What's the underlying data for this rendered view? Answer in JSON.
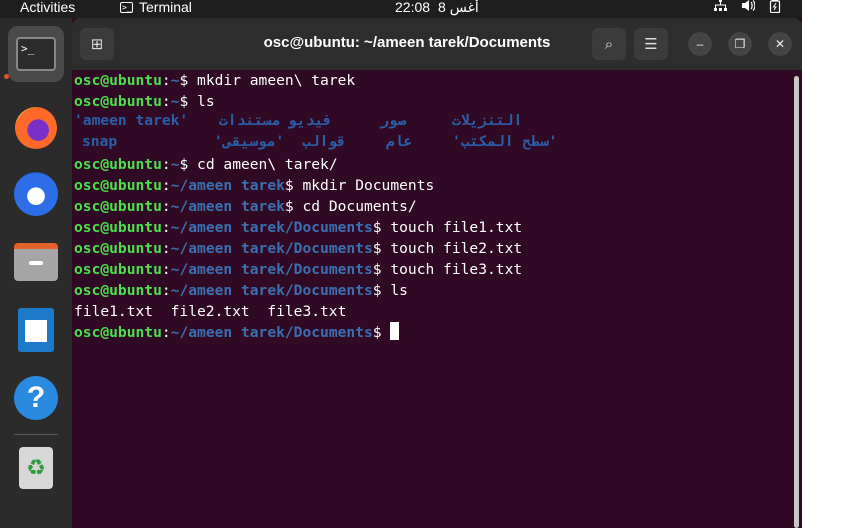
{
  "topbar": {
    "activities": "Activities",
    "app_name": "Terminal",
    "clock_time": "22:08",
    "clock_date": "8 أغس",
    "tray_icons": [
      "network-icon",
      "volume-icon",
      "battery-icon"
    ]
  },
  "dock": {
    "items": [
      "terminal",
      "firefox",
      "thunderbird",
      "files",
      "libreoffice-writer",
      "help",
      "trash"
    ]
  },
  "window": {
    "title": "osc@ubuntu: ~/ameen tarek/Documents",
    "new_tab_icon": "⊞",
    "search_icon": "⌕",
    "menu_icon": "☰",
    "minimize_icon": "–",
    "maximize_icon": "❐",
    "close_icon": "✕"
  },
  "terminal": {
    "user": "osc@ubuntu",
    "colon": ":",
    "home_path": "~",
    "path_ameen": "~/ameen tarek",
    "path_docs": "~/ameen tarek/Documents",
    "prompt_char": "$ ",
    "cmd1": "mkdir ameen\\ tarek",
    "cmd2": "ls",
    "ls_home": {
      "row1": [
        "'ameen tarek'",
        "مستندات",
        "فيديو",
        "صور",
        "التنزيلات"
      ],
      "row2": [
        "snap",
        "'سطح المكتب'",
        "عام",
        "قوالب",
        "'موسيقى'"
      ]
    },
    "cmd3": "cd ameen\\ tarek/",
    "cmd4": "mkdir Documents",
    "cmd5": "cd Documents/",
    "cmd6": "touch file1.txt",
    "cmd7": "touch file2.txt",
    "cmd8": "touch file3.txt",
    "cmd9": "ls",
    "ls_docs": "file1.txt  file2.txt  file3.txt"
  }
}
